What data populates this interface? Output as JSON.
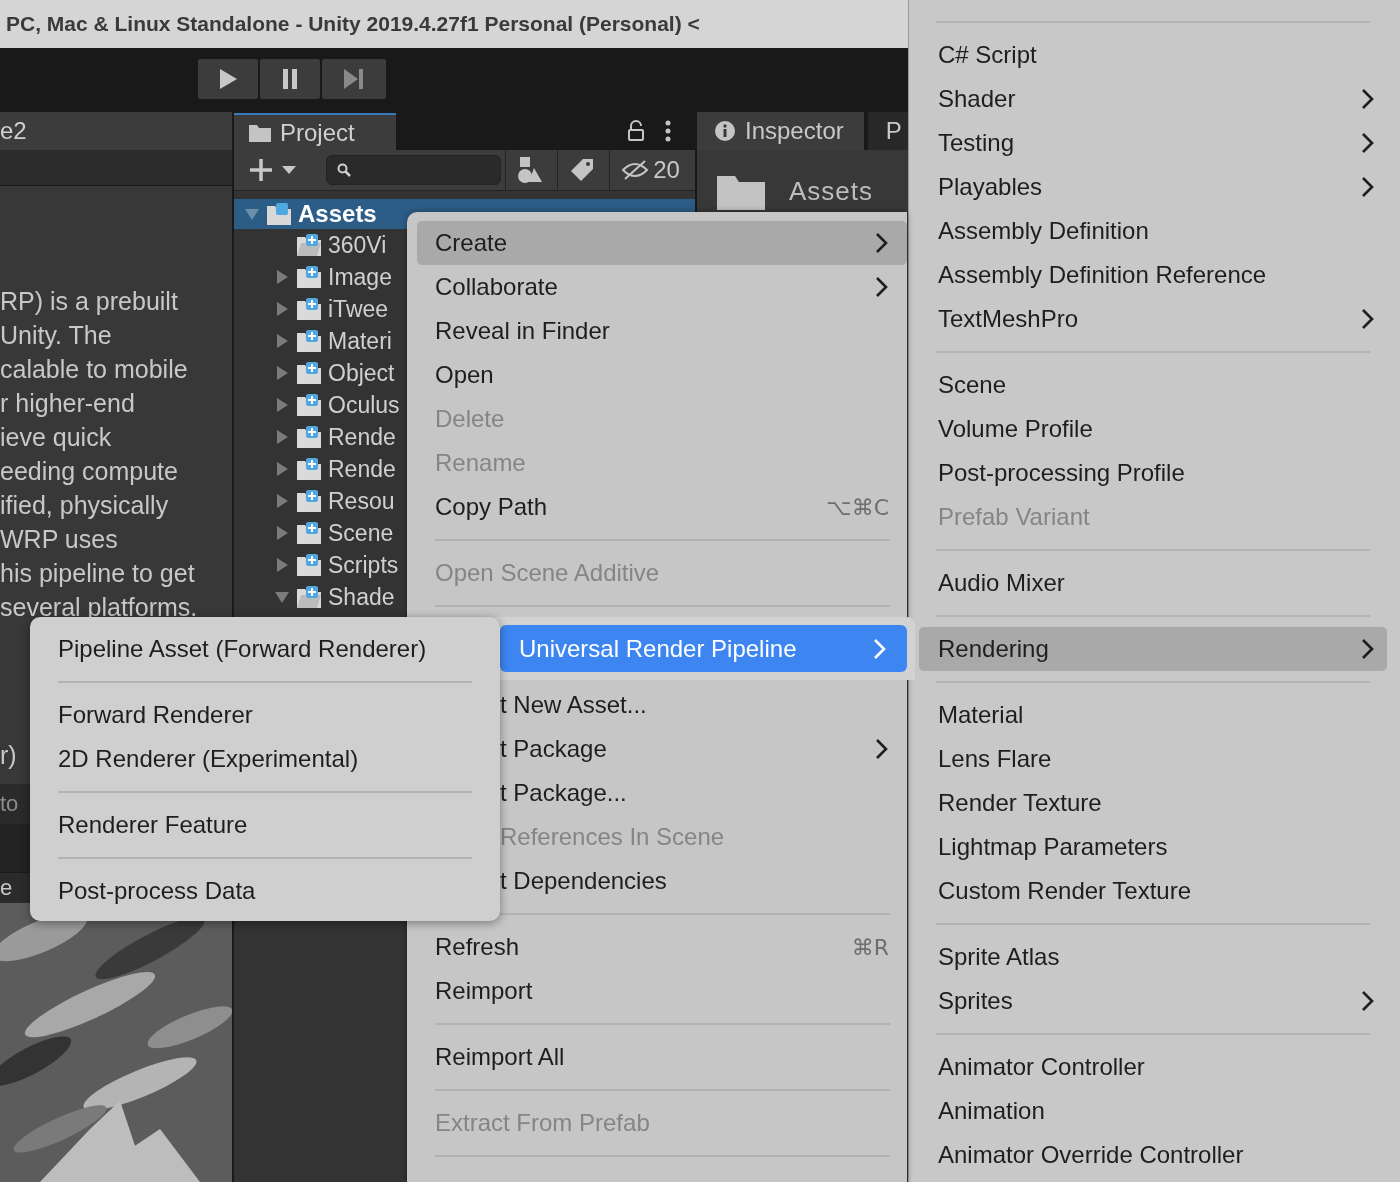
{
  "window": {
    "title": "PC, Mac & Linux Standalone - Unity 2019.4.27f1 Personal (Personal) <"
  },
  "toolbar": {
    "buttons": [
      {
        "kind": "play"
      },
      {
        "kind": "pause"
      },
      {
        "kind": "step"
      }
    ]
  },
  "scene_panel": {
    "tab": "e2",
    "description_lines": [
      "RP) is a prebuilt",
      "Unity. The",
      "calable to mobile",
      "r higher-end",
      "ieve quick",
      "eeding compute",
      "ified, physically",
      "WRP uses",
      "his pipeline to get",
      "several platforms."
    ],
    "label_fragment": "r)",
    "field_fragment": "to",
    "tab_fragment": "e"
  },
  "project": {
    "tab": {
      "label": "Project",
      "selected": true
    },
    "hidden_count": "20",
    "tree": [
      {
        "name": "Assets",
        "selected": true,
        "expanded": true,
        "children": [
          {
            "name": "360Vi",
            "kind": "leaf"
          },
          {
            "name": "Image",
            "kind": "folder",
            "expanded": false
          },
          {
            "name": "iTwee",
            "kind": "folder",
            "expanded": false
          },
          {
            "name": "Materi",
            "kind": "folder",
            "expanded": false
          },
          {
            "name": "Object",
            "kind": "folder",
            "expanded": false
          },
          {
            "name": "Oculus",
            "kind": "folder",
            "expanded": false
          },
          {
            "name": "Rende",
            "kind": "folder",
            "expanded": false
          },
          {
            "name": "Rende",
            "kind": "folder",
            "expanded": false
          },
          {
            "name": "Resou",
            "kind": "folder",
            "expanded": false
          },
          {
            "name": "Scene",
            "kind": "folder",
            "expanded": false
          },
          {
            "name": "Scripts",
            "kind": "folder",
            "expanded": false
          },
          {
            "name": "Shade",
            "kind": "folder",
            "expanded": true
          }
        ]
      }
    ]
  },
  "inspector": {
    "tabs": [
      {
        "label": "Inspector",
        "selected": true
      },
      {
        "label": "P",
        "selected": false
      }
    ],
    "header": "Assets"
  },
  "context_menu": {
    "items": [
      {
        "kind": "item",
        "label": "Create",
        "selected": true,
        "disabled": false,
        "submenu": true
      },
      {
        "kind": "item",
        "label": "Collaborate",
        "selected": false,
        "disabled": false,
        "submenu": true
      },
      {
        "kind": "item",
        "label": "Reveal in Finder",
        "selected": false,
        "disabled": false,
        "submenu": false
      },
      {
        "kind": "item",
        "label": "Open",
        "selected": false,
        "disabled": false,
        "submenu": false
      },
      {
        "kind": "item",
        "label": "Delete",
        "selected": false,
        "disabled": true,
        "submenu": false
      },
      {
        "kind": "item",
        "label": "Rename",
        "selected": false,
        "disabled": true,
        "submenu": false
      },
      {
        "kind": "item",
        "label": "Copy Path",
        "selected": false,
        "disabled": false,
        "submenu": false,
        "shortcut": "⌥⌘C"
      },
      {
        "kind": "separator"
      },
      {
        "kind": "item",
        "label": "Open Scene Additive",
        "selected": false,
        "disabled": true,
        "submenu": false
      },
      {
        "kind": "separator"
      }
    ],
    "items_lower": [
      {
        "kind": "item",
        "label": "t New Asset...",
        "selected": false,
        "disabled": false,
        "submenu": false,
        "partial": true
      },
      {
        "kind": "item",
        "label": "t Package",
        "selected": false,
        "disabled": false,
        "submenu": true,
        "partial": true
      },
      {
        "kind": "item",
        "label": "t Package...",
        "selected": false,
        "disabled": false,
        "submenu": false,
        "partial": true
      },
      {
        "kind": "item",
        "label": "References In Scene",
        "selected": false,
        "disabled": true,
        "submenu": false,
        "partial": true
      },
      {
        "kind": "item",
        "label": "t Dependencies",
        "selected": false,
        "disabled": false,
        "submenu": false,
        "partial": true
      },
      {
        "kind": "separator"
      },
      {
        "kind": "item",
        "label": "Refresh",
        "selected": false,
        "disabled": false,
        "submenu": false,
        "partial": false,
        "shortcut": "⌘R"
      },
      {
        "kind": "item",
        "label": "Reimport",
        "selected": false,
        "disabled": false,
        "submenu": false,
        "partial": false
      },
      {
        "kind": "separator"
      },
      {
        "kind": "item",
        "label": "Reimport All",
        "selected": false,
        "disabled": false,
        "submenu": false,
        "partial": false
      },
      {
        "kind": "separator"
      },
      {
        "kind": "item",
        "label": "Extract From Prefab",
        "selected": false,
        "disabled": true,
        "submenu": false,
        "partial": false
      },
      {
        "kind": "separator"
      }
    ]
  },
  "create_menu": {
    "items": [
      {
        "kind": "separator"
      },
      {
        "kind": "item",
        "label": "C# Script",
        "selected": false,
        "disabled": false,
        "submenu": false
      },
      {
        "kind": "item",
        "label": "Shader",
        "selected": false,
        "disabled": false,
        "submenu": true
      },
      {
        "kind": "item",
        "label": "Testing",
        "selected": false,
        "disabled": false,
        "submenu": true
      },
      {
        "kind": "item",
        "label": "Playables",
        "selected": false,
        "disabled": false,
        "submenu": true
      },
      {
        "kind": "item",
        "label": "Assembly Definition",
        "selected": false,
        "disabled": false,
        "submenu": false
      },
      {
        "kind": "item",
        "label": "Assembly Definition Reference",
        "selected": false,
        "disabled": false,
        "submenu": false
      },
      {
        "kind": "item",
        "label": "TextMeshPro",
        "selected": false,
        "disabled": false,
        "submenu": true
      },
      {
        "kind": "separator"
      },
      {
        "kind": "item",
        "label": "Scene",
        "selected": false,
        "disabled": false,
        "submenu": false
      },
      {
        "kind": "item",
        "label": "Volume Profile",
        "selected": false,
        "disabled": false,
        "submenu": false
      },
      {
        "kind": "item",
        "label": "Post-processing Profile",
        "selected": false,
        "disabled": false,
        "submenu": false
      },
      {
        "kind": "item",
        "label": "Prefab Variant",
        "selected": false,
        "disabled": true,
        "submenu": false
      },
      {
        "kind": "separator"
      },
      {
        "kind": "item",
        "label": "Audio Mixer",
        "selected": false,
        "disabled": false,
        "submenu": false
      },
      {
        "kind": "separator"
      },
      {
        "kind": "item",
        "label": "Rendering",
        "selected": true,
        "disabled": false,
        "submenu": true
      },
      {
        "kind": "separator"
      },
      {
        "kind": "item",
        "label": "Material",
        "selected": false,
        "disabled": false,
        "submenu": false
      },
      {
        "kind": "item",
        "label": "Lens Flare",
        "selected": false,
        "disabled": false,
        "submenu": false
      },
      {
        "kind": "item",
        "label": "Render Texture",
        "selected": false,
        "disabled": false,
        "submenu": false
      },
      {
        "kind": "item",
        "label": "Lightmap Parameters",
        "selected": false,
        "disabled": false,
        "submenu": false
      },
      {
        "kind": "item",
        "label": "Custom Render Texture",
        "selected": false,
        "disabled": false,
        "submenu": false
      },
      {
        "kind": "separator"
      },
      {
        "kind": "item",
        "label": "Sprite Atlas",
        "selected": false,
        "disabled": false,
        "submenu": false
      },
      {
        "kind": "item",
        "label": "Sprites",
        "selected": false,
        "disabled": false,
        "submenu": true
      },
      {
        "kind": "separator"
      },
      {
        "kind": "item",
        "label": "Animator Controller",
        "selected": false,
        "disabled": false,
        "submenu": false
      },
      {
        "kind": "item",
        "label": "Animation",
        "selected": false,
        "disabled": false,
        "submenu": false
      },
      {
        "kind": "item",
        "label": "Animator Override Controller",
        "selected": false,
        "disabled": false,
        "submenu": false
      }
    ]
  },
  "rendering_menu": {
    "items": [
      {
        "kind": "item",
        "label": "Universal Render Pipeline",
        "selected": true,
        "submenu": true
      }
    ]
  },
  "urp_menu": {
    "items": [
      {
        "kind": "item",
        "label": "Pipeline Asset (Forward Renderer)",
        "selected": false,
        "disabled": false
      },
      {
        "kind": "separator"
      },
      {
        "kind": "item",
        "label": "Forward Renderer",
        "selected": false,
        "disabled": false
      },
      {
        "kind": "item",
        "label": "2D Renderer (Experimental)",
        "selected": false,
        "disabled": false
      },
      {
        "kind": "separator"
      },
      {
        "kind": "item",
        "label": "Renderer Feature",
        "selected": false,
        "disabled": false
      },
      {
        "kind": "separator"
      },
      {
        "kind": "item",
        "label": "Post-process Data",
        "selected": false,
        "disabled": false
      }
    ]
  }
}
